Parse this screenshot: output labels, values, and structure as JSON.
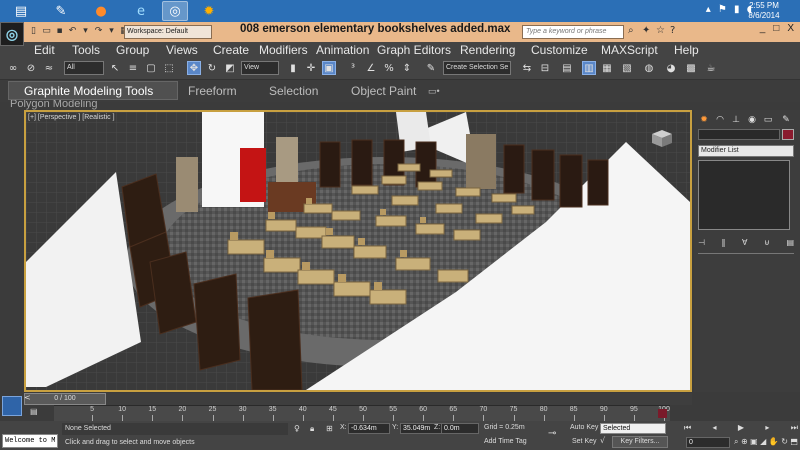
{
  "taskbar": {
    "time": "2:55 PM",
    "date": "8/6/2014",
    "icons": [
      "folder-icon",
      "notes-icon",
      "firefox-icon",
      "ie-icon",
      "max-app-icon",
      "paint-app-icon"
    ]
  },
  "window": {
    "title": "008 emerson elementary  bookshelves added.max",
    "workspace": "Workspace: Default",
    "search_placeholder": "Type a keyword or phrase",
    "controls": [
      "_",
      "□",
      "X"
    ]
  },
  "menu": [
    "Edit",
    "Tools",
    "Group",
    "Views",
    "Create",
    "Modifiers",
    "Animation",
    "Graph Editors",
    "Rendering",
    "Customize",
    "MAXScript",
    "Help"
  ],
  "toolbar": {
    "filter": "All",
    "view_coord": "View",
    "selection_set": "Create Selection Se"
  },
  "ribbon": {
    "tabs": [
      "Graphite Modeling Tools",
      "Freeform",
      "Selection",
      "Object Paint"
    ],
    "sub_label": "Polygon Modeling"
  },
  "viewport": {
    "label": "[+] [Perspective ] [Realistic ]"
  },
  "command_panel": {
    "modifier_list": "Modifier List"
  },
  "timeline": {
    "frame_display": "0 / 100",
    "ticks": [
      "5",
      "10",
      "15",
      "20",
      "25",
      "30",
      "35",
      "40",
      "45",
      "50",
      "55",
      "60",
      "65",
      "70",
      "75",
      "80",
      "85",
      "90",
      "95",
      "100"
    ]
  },
  "status": {
    "listener": "Welcome to M",
    "selection": "None Selected",
    "prompt": "Click and drag to select and move objects",
    "x_label": "X:",
    "x_value": "-0.634m",
    "y_label": "Y:",
    "y_value": "35.049m",
    "z_label": "Z:",
    "z_value": "0.0m",
    "grid": "Grid = 0.25m",
    "add_time_tag": "Add Time Tag",
    "auto_key": "Auto Key",
    "set_key": "Set Key",
    "key_mode": "Selected",
    "key_filters": "Key Filters...",
    "frame": "0"
  },
  "colors": {
    "taskbar": "#2b6fb6",
    "titlebar": "#e9b88a",
    "ui_dark": "#444444",
    "viewport_border": "#c8a040",
    "material_color": "#8a1a2e"
  }
}
